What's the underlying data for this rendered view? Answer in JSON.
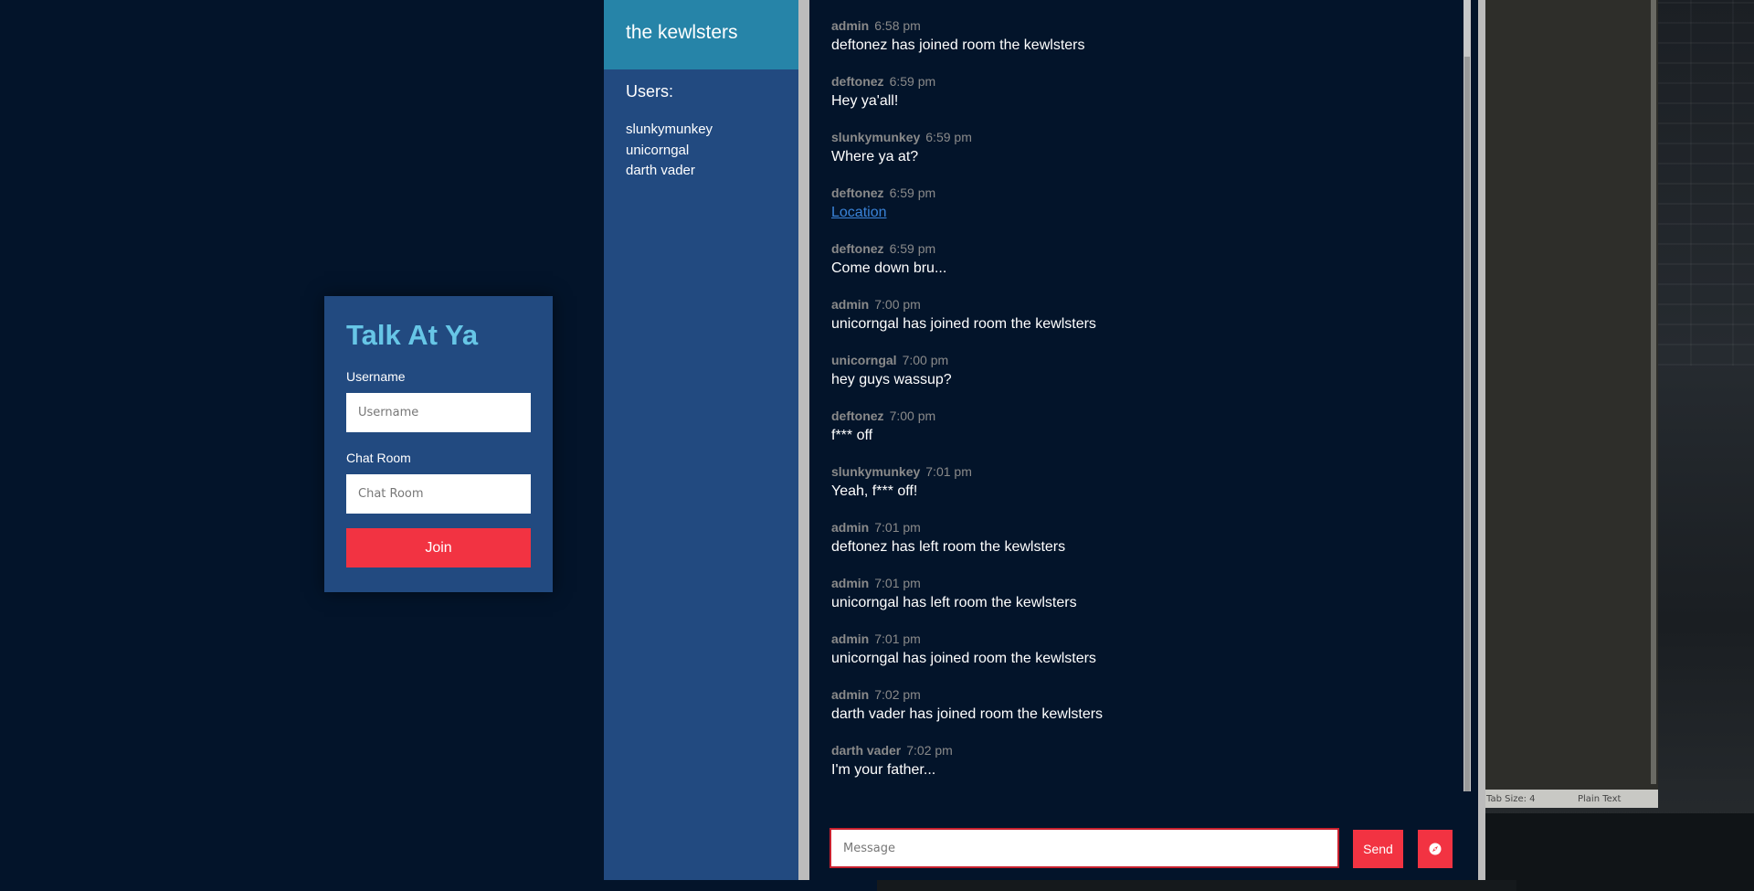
{
  "login": {
    "title": "Talk At Ya",
    "username_label": "Username",
    "username_placeholder": "Username",
    "room_label": "Chat Room",
    "room_placeholder": "Chat Room",
    "join_label": "Join"
  },
  "sidebar": {
    "room_name": "the kewlsters",
    "users_title": "Users:",
    "users": [
      "slunkymunkey",
      "unicorngal",
      "darth vader"
    ]
  },
  "messages": [
    {
      "name": "admin",
      "time": "6:58 pm",
      "text": "deftonez has joined room the kewlsters"
    },
    {
      "name": "deftonez",
      "time": "6:59 pm",
      "text": "Hey ya'all!"
    },
    {
      "name": "slunkymunkey",
      "time": "6:59 pm",
      "text": "Where ya at?"
    },
    {
      "name": "deftonez",
      "time": "6:59 pm",
      "link": "Location"
    },
    {
      "name": "deftonez",
      "time": "6:59 pm",
      "text": "Come down bru..."
    },
    {
      "name": "admin",
      "time": "7:00 pm",
      "text": "unicorngal has joined room the kewlsters"
    },
    {
      "name": "unicorngal",
      "time": "7:00 pm",
      "text": "hey guys wassup?"
    },
    {
      "name": "deftonez",
      "time": "7:00 pm",
      "text": "f*** off"
    },
    {
      "name": "slunkymunkey",
      "time": "7:01 pm",
      "text": "Yeah, f*** off!"
    },
    {
      "name": "admin",
      "time": "7:01 pm",
      "text": "deftonez has left room the kewlsters"
    },
    {
      "name": "admin",
      "time": "7:01 pm",
      "text": "unicorngal has left room the kewlsters"
    },
    {
      "name": "admin",
      "time": "7:01 pm",
      "text": "unicorngal has joined room the kewlsters"
    },
    {
      "name": "admin",
      "time": "7:02 pm",
      "text": "darth vader has joined room the kewlsters"
    },
    {
      "name": "darth vader",
      "time": "7:02 pm",
      "text": "I'm your father..."
    }
  ],
  "compose": {
    "placeholder": "Message",
    "send_label": "Send",
    "location_icon": "compass-icon"
  },
  "editor_status": {
    "tab_size": "Tab Size: 4",
    "syntax": "Plain Text"
  },
  "colors": {
    "accent": "#f23342",
    "panel": "#224a80",
    "header": "#2684a8",
    "title": "#67c6e6",
    "background": "#03142a"
  }
}
